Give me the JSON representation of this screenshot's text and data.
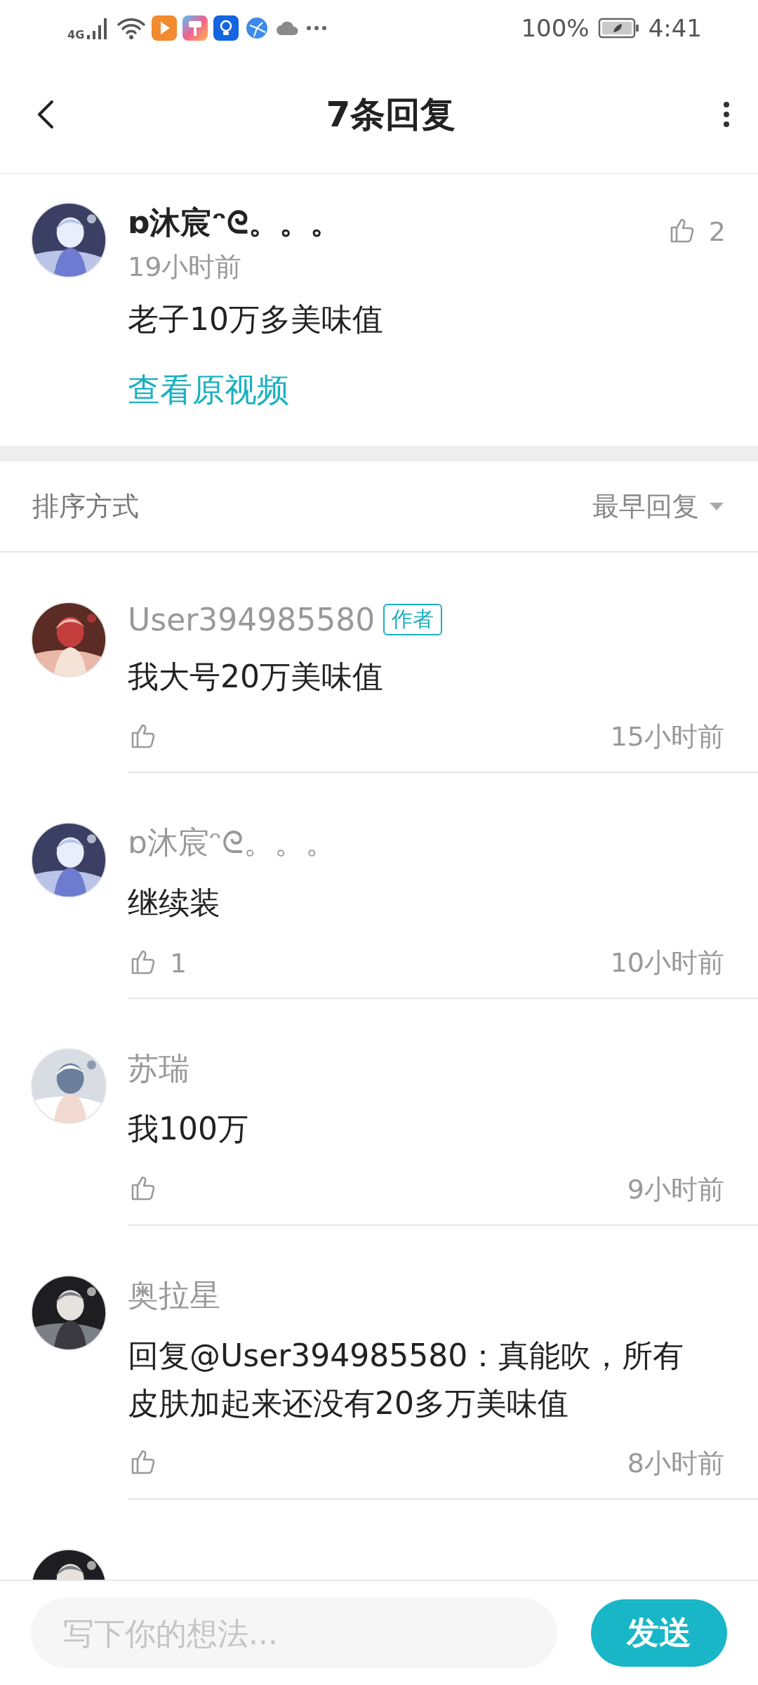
{
  "status_bar": {
    "network": "4G",
    "battery": "100%",
    "time": "4:41"
  },
  "header": {
    "title": "7条回复"
  },
  "comment": {
    "user": "ɒ沐宸ᵔᘓ。。。",
    "time": "19小时前",
    "text": "老子10万多美味值",
    "likes": "2",
    "link": "查看原视频"
  },
  "sort": {
    "label": "排序方式",
    "value": "最早回复"
  },
  "replies": [
    {
      "kind": "full",
      "user": "User394985580",
      "badge": "作者",
      "text": "我大号20万美味值",
      "time": "15小时前"
    },
    {
      "kind": "full",
      "user": "ɒ沐宸ᵔᘓ。。。",
      "text": "继续装",
      "likes": "1",
      "time": "10小时前"
    },
    {
      "kind": "full",
      "user": "苏瑞",
      "text": "我100万",
      "time": "9小时前"
    },
    {
      "kind": "full",
      "user": "奥拉星",
      "text": "回复@User394985580：真能吹，所有皮肤加起来还没有20多万美味值",
      "time": "8小时前"
    },
    {
      "kind": "cut"
    }
  ],
  "composer": {
    "placeholder": "写下你的想法...",
    "send": "发送"
  }
}
